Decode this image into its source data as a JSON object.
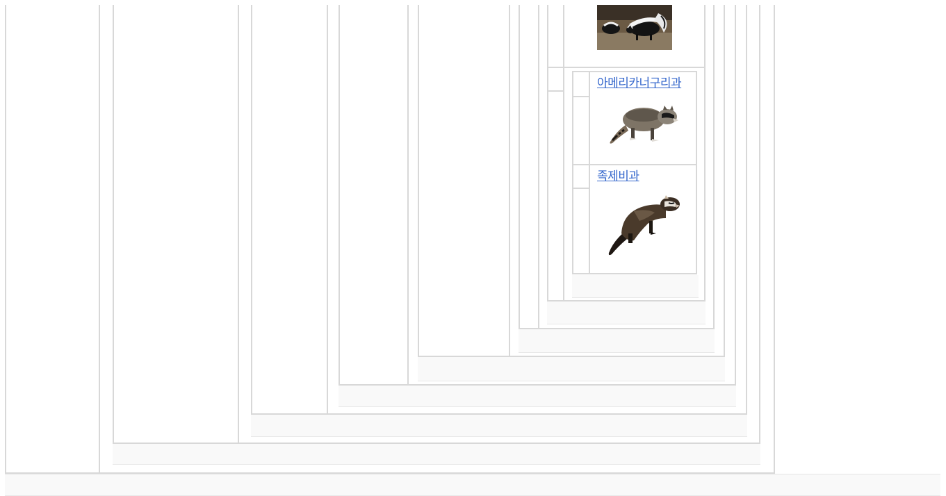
{
  "taxonomy_box": {
    "families": [
      {
        "id": "mephitidae",
        "image": {
          "icon": "skunk-photo",
          "alt": ""
        }
      },
      {
        "id": "procyonidae",
        "label": "아메리카너구리과",
        "image": {
          "icon": "raccoon-photo",
          "alt": ""
        }
      },
      {
        "id": "mustelidae",
        "label": "족제비과",
        "image": {
          "icon": "ferret-photo",
          "alt": ""
        }
      }
    ]
  },
  "colors": {
    "border": "#d8d8d8",
    "link": "#3366cc",
    "footer_bar": "#f9f9f9"
  }
}
